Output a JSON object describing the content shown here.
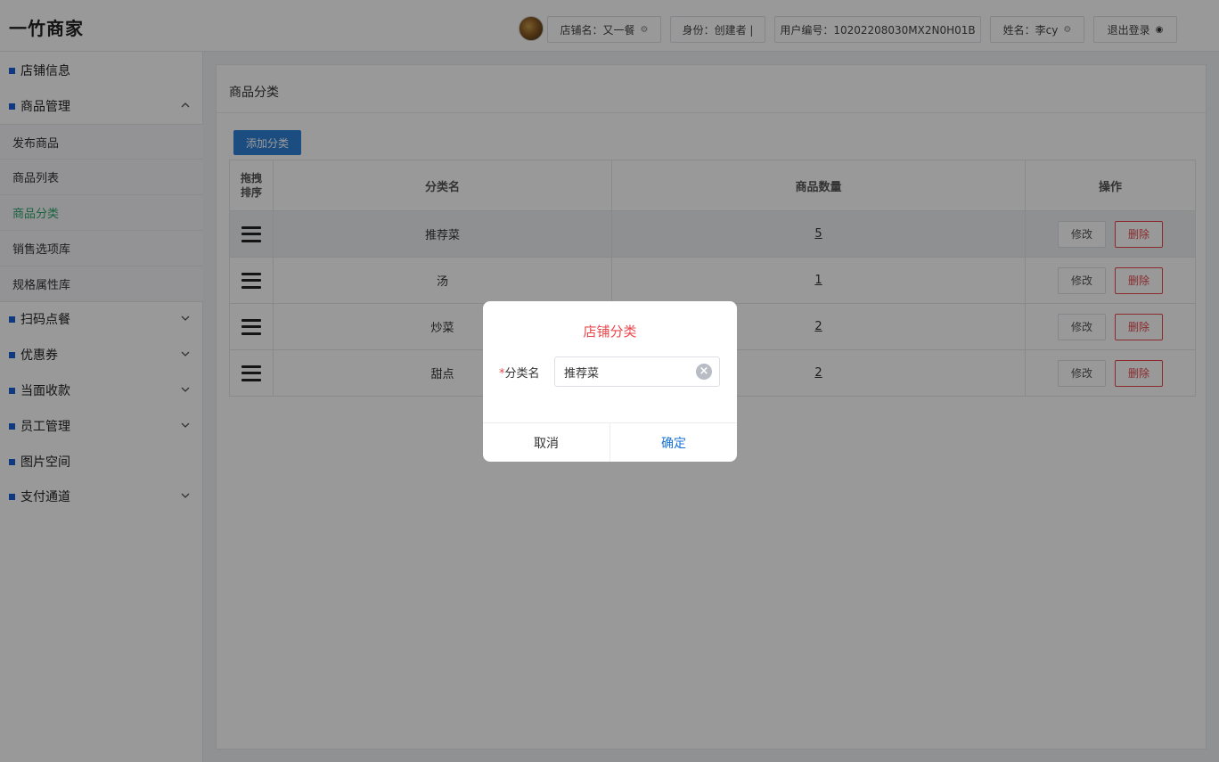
{
  "app": {
    "brand": "一竹商家"
  },
  "header": {
    "store_name": "店铺名：又一餐",
    "role": "身份：创建者 |",
    "user_id": "用户编号：10202208030MX2N0H01B",
    "user_name": "姓名：李cy",
    "logout": "退出登录"
  },
  "sidebar": {
    "items": [
      {
        "label": "店铺信息"
      },
      {
        "label": "商品管理"
      },
      {
        "label": "扫码点餐"
      },
      {
        "label": "优惠券"
      },
      {
        "label": "当面收款"
      },
      {
        "label": "员工管理"
      },
      {
        "label": "图片空间"
      },
      {
        "label": "支付通道"
      }
    ],
    "sub_items": [
      {
        "label": "发布商品"
      },
      {
        "label": "商品列表"
      },
      {
        "label": "商品分类"
      },
      {
        "label": "销售选项库"
      },
      {
        "label": "规格属性库"
      }
    ]
  },
  "main": {
    "title": "商品分类",
    "add_button": "添加分类",
    "table": {
      "headers": {
        "drag_line1": "拖拽",
        "drag_line2": "排序",
        "name": "分类名",
        "count": "商品数量",
        "ops": "操作"
      },
      "rows": [
        {
          "name": "推荐菜",
          "count": "5"
        },
        {
          "name": "汤",
          "count": "1"
        },
        {
          "name": "炒菜",
          "count": "2"
        },
        {
          "name": "甜点",
          "count": "2"
        }
      ],
      "edit_label": "修改",
      "delete_label": "删除"
    }
  },
  "dialog": {
    "title": "店铺分类",
    "required_mark": "*",
    "field_label": "分类名",
    "field_value": "推荐菜",
    "cancel": "取消",
    "confirm": "确定"
  },
  "colors": {
    "accent": "#2f80d8",
    "danger": "#e8484d",
    "active_menu": "#2aa56a",
    "menu_marker": "#1a5fd6"
  }
}
